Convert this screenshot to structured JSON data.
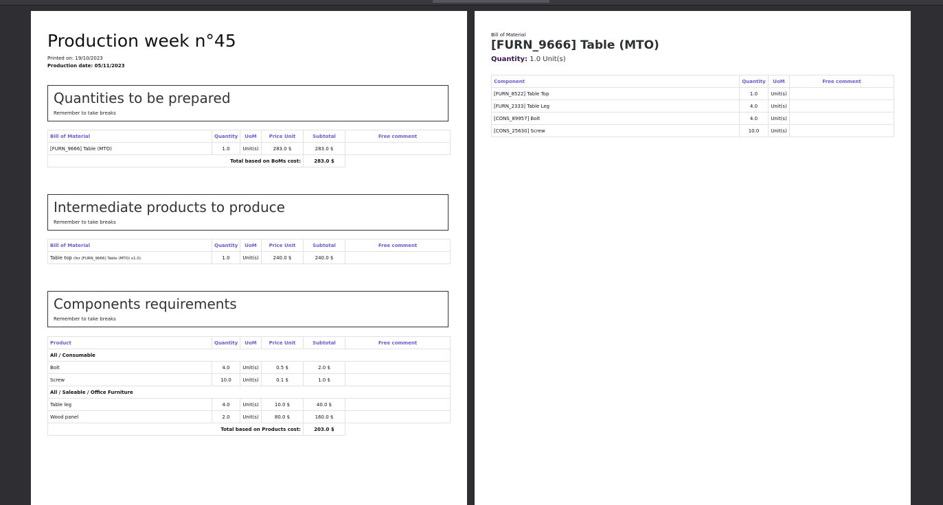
{
  "viewer": {
    "label": ""
  },
  "page1": {
    "title": "Production week n°45",
    "printed_on": "Printed on: 19/10/2023",
    "production_date": "Production date: 05/11/2023",
    "sections": [
      {
        "heading": "Quantities to be prepared",
        "note": "Remember to take breaks",
        "columns": [
          "Bill of Material",
          "Quantity",
          "UoM",
          "Price Unit",
          "Subtotal",
          "Free comment"
        ],
        "rows": [
          {
            "name": "[FURN_9666] Table (MTO)",
            "qty": "1.0",
            "uom": "Unit(s)",
            "price": "283.0 $",
            "subtotal": "283.0 $",
            "comment": ""
          }
        ],
        "total_label": "Total based on BoMs cost:",
        "total_value": "283.0 $"
      },
      {
        "heading": "Intermediate products to produce",
        "note": "Remember to take breaks",
        "columns": [
          "Bill of Material",
          "Quantity",
          "UoM",
          "Price Unit",
          "Subtotal",
          "Free comment"
        ],
        "rows": [
          {
            "name": "Table top",
            "name_suffix": "(for [FURN_9666] Table (MTO) x1.0)",
            "qty": "1.0",
            "uom": "Unit(s)",
            "price": "240.0 $",
            "subtotal": "240.0 $",
            "comment": ""
          }
        ]
      },
      {
        "heading": "Components requirements",
        "note": "Remember to take breaks",
        "columns": [
          "Product",
          "Quantity",
          "UoM",
          "Price Unit",
          "Subtotal",
          "Free comment"
        ],
        "groups": [
          {
            "name": "All / Consumable",
            "rows": [
              {
                "name": "Bolt",
                "qty": "4.0",
                "uom": "Unit(s)",
                "price": "0.5 $",
                "subtotal": "2.0 $",
                "comment": ""
              },
              {
                "name": "Screw",
                "qty": "10.0",
                "uom": "Unit(s)",
                "price": "0.1 $",
                "subtotal": "1.0 $",
                "comment": ""
              }
            ]
          },
          {
            "name": "All / Saleable / Office Furniture",
            "rows": [
              {
                "name": "Table leg",
                "qty": "4.0",
                "uom": "Unit(s)",
                "price": "10.0 $",
                "subtotal": "40.0 $",
                "comment": ""
              },
              {
                "name": "Wood panel",
                "qty": "2.0",
                "uom": "Unit(s)",
                "price": "80.0 $",
                "subtotal": "160.0 $",
                "comment": ""
              }
            ]
          }
        ],
        "total_label": "Total based on Products cost:",
        "total_value": "203.0 $"
      }
    ]
  },
  "page2": {
    "kicker": "Bill of Material",
    "title": "[FURN_9666] Table (MTO)",
    "quantity_label": "Quantity:",
    "quantity_value": "1.0 Unit(s)",
    "columns": [
      "Component",
      "Quantity",
      "UoM",
      "Free comment"
    ],
    "rows": [
      {
        "name": "[FURN_8522] Table Top",
        "qty": "1.0",
        "uom": "Unit(s)",
        "comment": ""
      },
      {
        "name": "[FURN_2333] Table Leg",
        "qty": "4.0",
        "uom": "Unit(s)",
        "comment": ""
      },
      {
        "name": "[CONS_89957] Bolt",
        "qty": "4.0",
        "uom": "Unit(s)",
        "comment": ""
      },
      {
        "name": "[CONS_25630] Screw",
        "qty": "10.0",
        "uom": "Unit(s)",
        "comment": ""
      }
    ]
  },
  "colors": {
    "header_text": "#6f5bd8",
    "viewer_bg": "#2f2f33",
    "page_bg": "#ffffff"
  }
}
